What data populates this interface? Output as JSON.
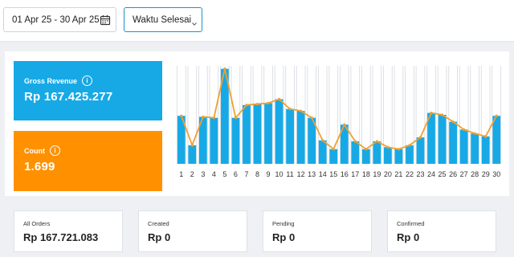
{
  "filters": {
    "date_range": "01 Apr 25 - 30 Apr 25",
    "calendar_icon": "calendar-icon",
    "sort_select": "Waktu Selesai",
    "sort_icon": "chevron-down-icon"
  },
  "cards": {
    "revenue": {
      "label": "Gross Revenue",
      "info": "i",
      "value": "Rp 167.425.277",
      "color": "#17a9e6"
    },
    "count": {
      "label": "Count",
      "info": "i",
      "value": "1.699",
      "color": "#ff9100"
    }
  },
  "stats": [
    {
      "label": "All Orders",
      "value": "Rp 167.721.083"
    },
    {
      "label": "Created",
      "value": "Rp 0"
    },
    {
      "label": "Pending",
      "value": "Rp 0"
    },
    {
      "label": "Confirmed",
      "value": "Rp 0"
    }
  ],
  "chart_data": {
    "type": "bar",
    "categories": [
      "1",
      "2",
      "3",
      "4",
      "5",
      "6",
      "7",
      "8",
      "9",
      "10",
      "11",
      "12",
      "13",
      "14",
      "15",
      "16",
      "17",
      "18",
      "19",
      "20",
      "21",
      "22",
      "23",
      "24",
      "25",
      "26",
      "27",
      "28",
      "29",
      "30"
    ],
    "series": [
      {
        "values": [
          49,
          19,
          48,
          47,
          97,
          47,
          60,
          61,
          62,
          66,
          56,
          54,
          47,
          24,
          15,
          40,
          23,
          15,
          23,
          17,
          15,
          19,
          27,
          52,
          50,
          43,
          35,
          31,
          28,
          49
        ],
        "color": "#17a9e6"
      }
    ],
    "line_color": "#f0a030",
    "ylim": [
      0,
      100
    ],
    "grid": true
  }
}
